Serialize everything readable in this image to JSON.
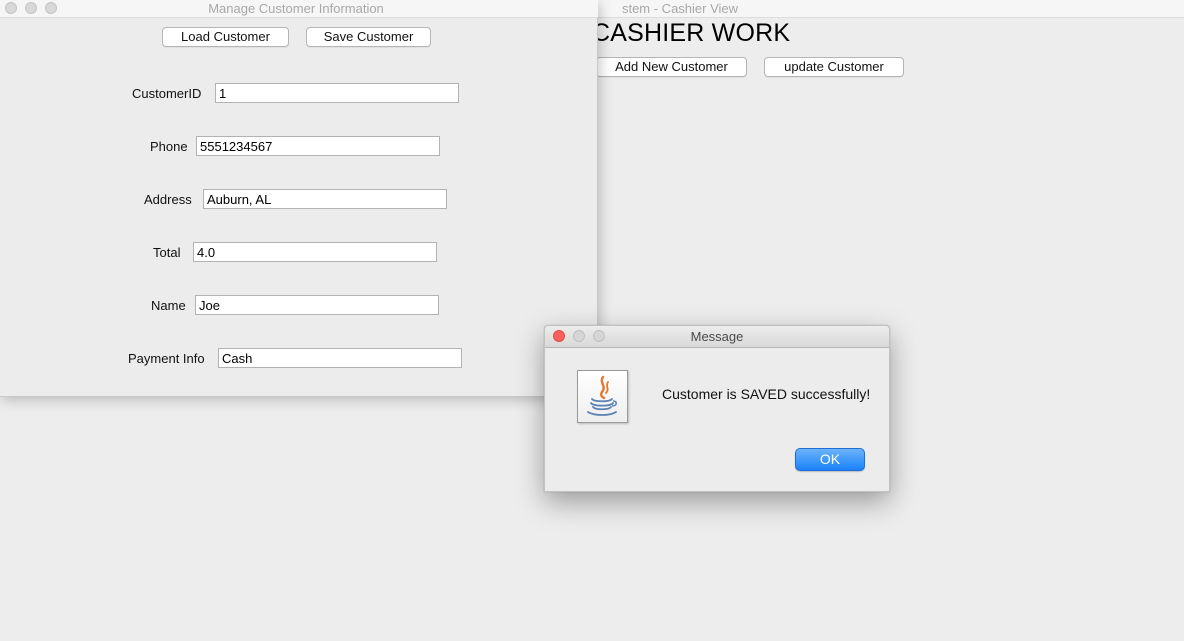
{
  "cashier_window": {
    "title": "stem - Cashier View",
    "heading": "CASHIER WORK",
    "add_button": "Add New Customer",
    "update_button": "update Customer"
  },
  "customer_window": {
    "title": "Manage Customer Information",
    "load_button": "Load Customer",
    "save_button": "Save Customer",
    "fields": {
      "customer_id": {
        "label": "CustomerID",
        "value": "1"
      },
      "phone": {
        "label": "Phone",
        "value": "5551234567"
      },
      "address": {
        "label": "Address",
        "value": "Auburn, AL"
      },
      "total": {
        "label": "Total",
        "value": "4.0"
      },
      "name": {
        "label": "Name",
        "value": "Joe"
      },
      "payment": {
        "label": "Payment Info",
        "value": "Cash"
      }
    }
  },
  "message_dialog": {
    "title": "Message",
    "message": "Customer is SAVED successfully!",
    "ok_button": "OK",
    "icon": "java-icon"
  },
  "colors": {
    "close_red": "#fc605c",
    "ok_blue": "#1a82fb",
    "window_bg": "#ececec"
  }
}
